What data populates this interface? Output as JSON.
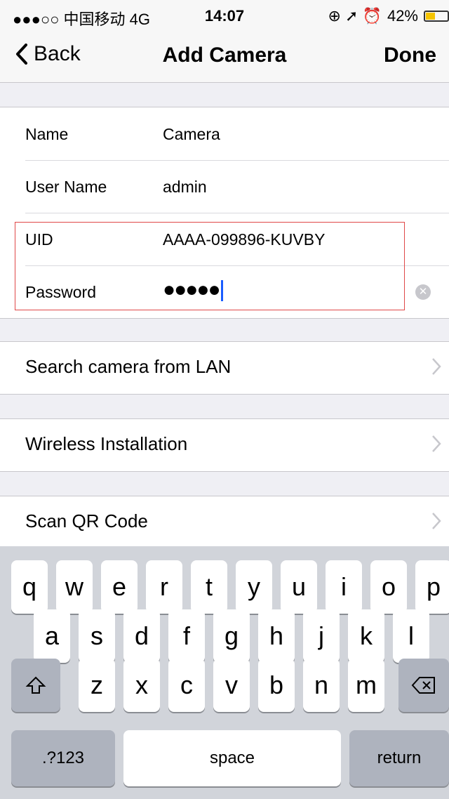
{
  "status_bar": {
    "carrier": "●●●○○ 中国移动  4G",
    "time": "14:07",
    "right_icons": "⊕ ➚ ⏰",
    "battery_percent": "42%",
    "battery_level": 0.42,
    "battery_color": "#f5c400"
  },
  "navbar": {
    "back_label": "Back",
    "title": "Add Camera",
    "done_label": "Done"
  },
  "form": {
    "fields": [
      {
        "label": "Name",
        "value": "Camera"
      },
      {
        "label": "User Name",
        "value": "admin"
      },
      {
        "label": "UID",
        "value": "AAAA-099896-KUVBY"
      },
      {
        "label": "Password",
        "value": "●●●●●"
      }
    ],
    "highlight_color": "#e04848"
  },
  "actions": [
    {
      "label": "Search camera from LAN"
    },
    {
      "label": "Wireless Installation"
    },
    {
      "label": "Scan QR Code"
    }
  ],
  "keyboard": {
    "row1": [
      "q",
      "w",
      "e",
      "r",
      "t",
      "y",
      "u",
      "i",
      "o",
      "p"
    ],
    "row2": [
      "a",
      "s",
      "d",
      "f",
      "g",
      "h",
      "j",
      "k",
      "l"
    ],
    "row3": [
      "z",
      "x",
      "c",
      "v",
      "b",
      "n",
      "m"
    ],
    "numbers_label": ".?123",
    "space_label": "space",
    "return_label": "return",
    "shift_icon": "shift-icon",
    "delete_icon": "backspace-icon"
  }
}
